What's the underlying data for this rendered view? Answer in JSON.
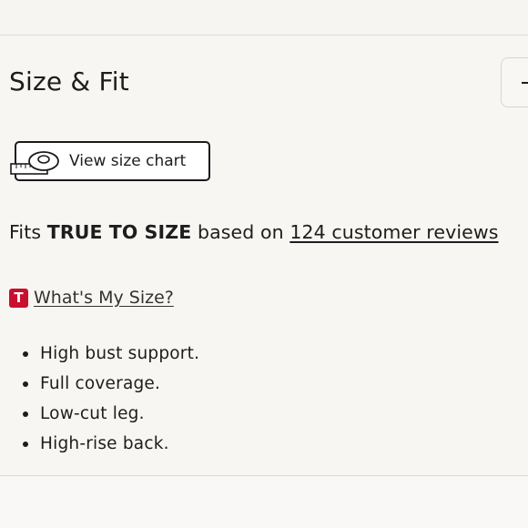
{
  "section": {
    "title": "Size & Fit"
  },
  "size_chart": {
    "label": "View size chart"
  },
  "fit": {
    "prefix": "Fits",
    "emphasis": "TRUE TO SIZE",
    "middle": "based on",
    "reviews_link": "124 customer reviews"
  },
  "whats_my_size": {
    "icon_letter": "T",
    "label": "What's My Size?"
  },
  "features": [
    "High bust support.",
    "Full coverage.",
    "Low-cut leg.",
    "High-rise back."
  ],
  "colors": {
    "background": "#f8f6f3",
    "brand_red": "#c8102e",
    "text": "#1d1d1d"
  }
}
